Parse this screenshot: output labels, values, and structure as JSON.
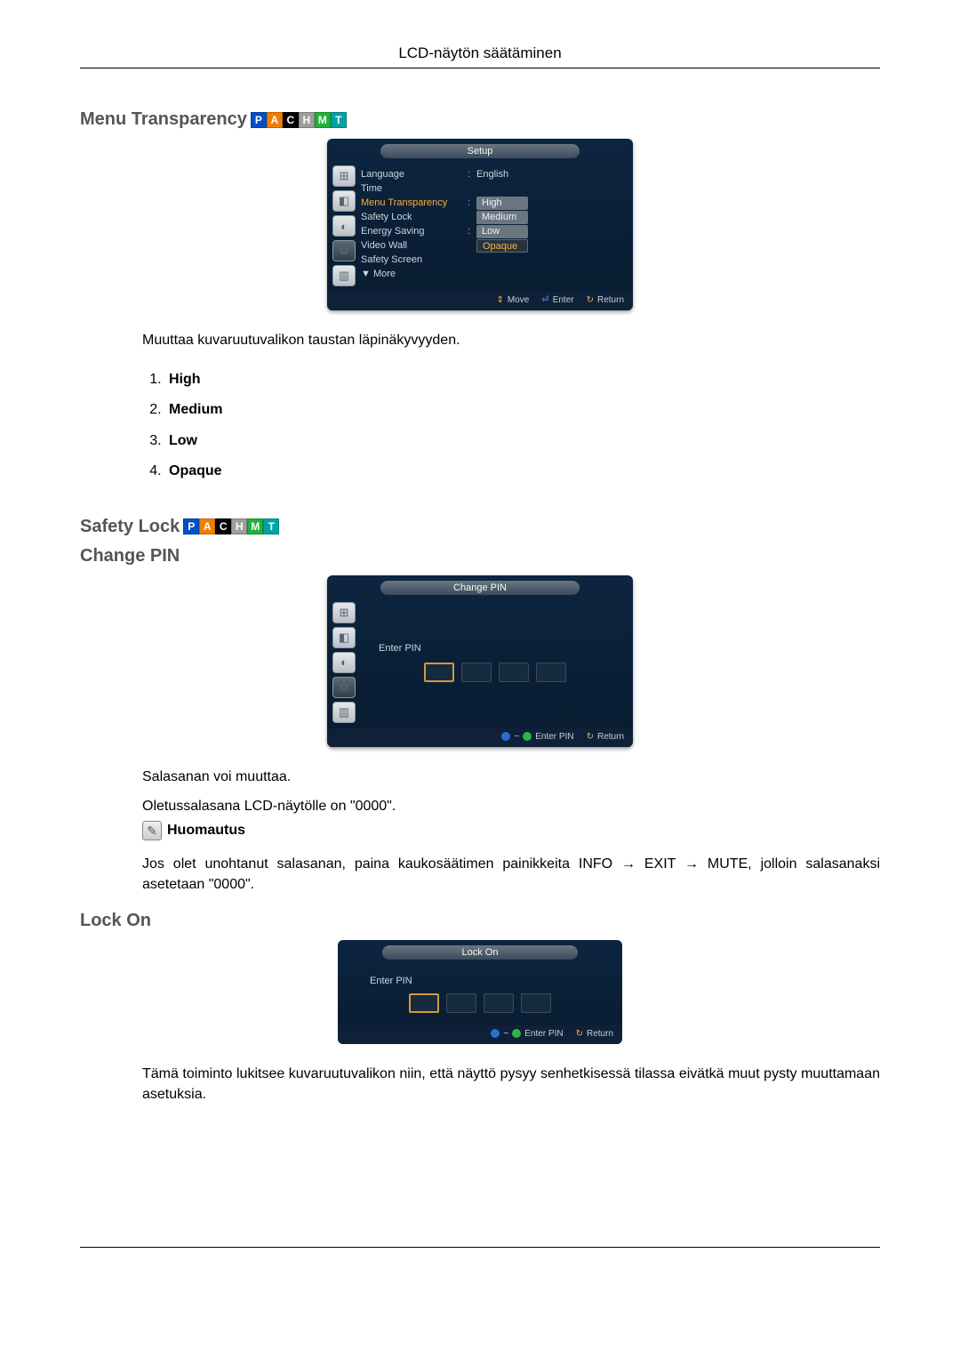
{
  "page": {
    "header_title": "LCD-näytön säätäminen"
  },
  "sections": {
    "menu_transparency": {
      "heading": "Menu Transparency",
      "badges": [
        "P",
        "A",
        "C",
        "H",
        "M",
        "T"
      ],
      "description": "Muuttaa kuvaruutuvalikon taustan läpinäkyvyyden.",
      "options": [
        "High",
        "Medium",
        "Low",
        "Opaque"
      ]
    },
    "safety_lock": {
      "heading": "Safety Lock",
      "badges": [
        "P",
        "A",
        "C",
        "H",
        "M",
        "T"
      ]
    },
    "change_pin": {
      "heading": "Change PIN",
      "para1": "Salasanan voi muuttaa.",
      "para2": "Oletussalasana LCD-näytölle on \"0000\".",
      "note_label": "Huomautus",
      "note_text": "Jos olet unohtanut salasanan, paina kaukosäätimen painikkeita INFO → EXIT → MUTE, jolloin salasanaksi asetetaan \"0000\"."
    },
    "lock_on": {
      "heading": "Lock On",
      "description": "Tämä toiminto lukitsee kuvaruutuvalikon niin, että näyttö pysyy senhetkisessä tilassa eivätkä muut pysty muuttamaan asetuksia."
    }
  },
  "osd_setup": {
    "title": "Setup",
    "rows": {
      "language": {
        "label": "Language",
        "value": "English"
      },
      "time": {
        "label": "Time",
        "value": ""
      },
      "menu_transparency": {
        "label": "Menu Transparency",
        "value": ""
      },
      "safety_lock": {
        "label": "Safety Lock",
        "value": ""
      },
      "energy_saving": {
        "label": "Energy Saving",
        "value": ""
      },
      "video_wall": {
        "label": "Video Wall",
        "value": ""
      },
      "safety_screen": {
        "label": "Safety Screen",
        "value": ""
      },
      "more": {
        "label": "▼ More",
        "value": ""
      }
    },
    "popup": [
      "High",
      "Medium",
      "Low",
      "Opaque"
    ],
    "footer": {
      "move": "Move",
      "enter": "Enter",
      "return": "Return"
    }
  },
  "osd_changepin": {
    "title": "Change PIN",
    "label": "Enter PIN",
    "footer": {
      "enter_pin": "Enter PIN",
      "return": "Return"
    }
  },
  "osd_lockon": {
    "title": "Lock On",
    "label": "Enter PIN",
    "footer": {
      "enter_pin": "Enter PIN",
      "return": "Return"
    }
  }
}
